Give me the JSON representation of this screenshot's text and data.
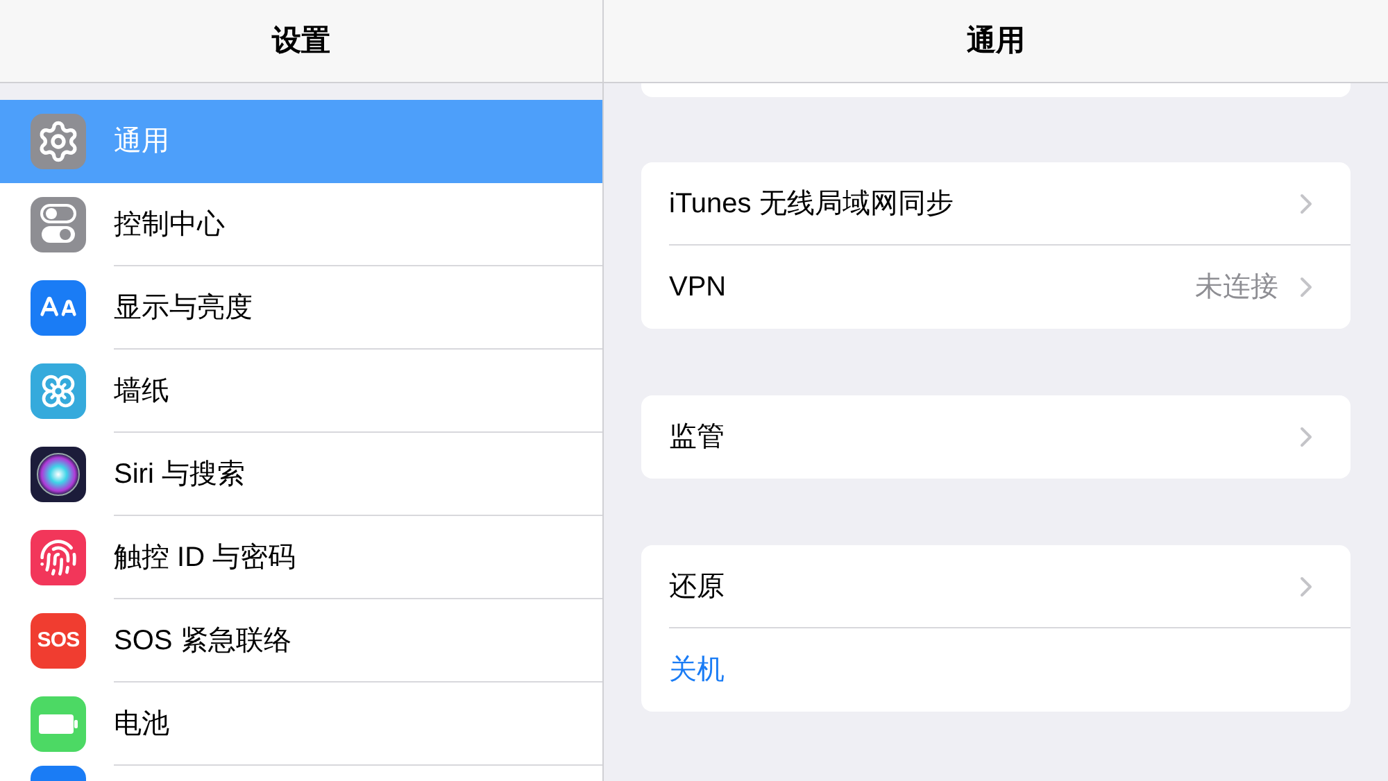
{
  "sidebar": {
    "title": "设置",
    "items": [
      {
        "kind": "general",
        "label": "通用",
        "selected": true
      },
      {
        "kind": "control",
        "label": "控制中心",
        "selected": false
      },
      {
        "kind": "display",
        "label": "显示与亮度",
        "selected": false
      },
      {
        "kind": "wallpaper",
        "label": "墙纸",
        "selected": false
      },
      {
        "kind": "siri",
        "label": "Siri 与搜索",
        "selected": false
      },
      {
        "kind": "touchid",
        "label": "触控 ID 与密码",
        "selected": false
      },
      {
        "kind": "sos",
        "label": "SOS 紧急联络",
        "selected": false,
        "icon_text": "SOS"
      },
      {
        "kind": "battery",
        "label": "电池",
        "selected": false
      }
    ]
  },
  "detail": {
    "title": "通用",
    "groups": [
      [
        {
          "kind": "link",
          "label": "iTunes 无线局域网同步"
        },
        {
          "kind": "link",
          "label": "VPN",
          "value": "未连接"
        }
      ],
      [
        {
          "kind": "link",
          "label": "监管"
        }
      ],
      [
        {
          "kind": "link",
          "label": "还原"
        },
        {
          "kind": "action",
          "label": "关机"
        }
      ]
    ]
  }
}
